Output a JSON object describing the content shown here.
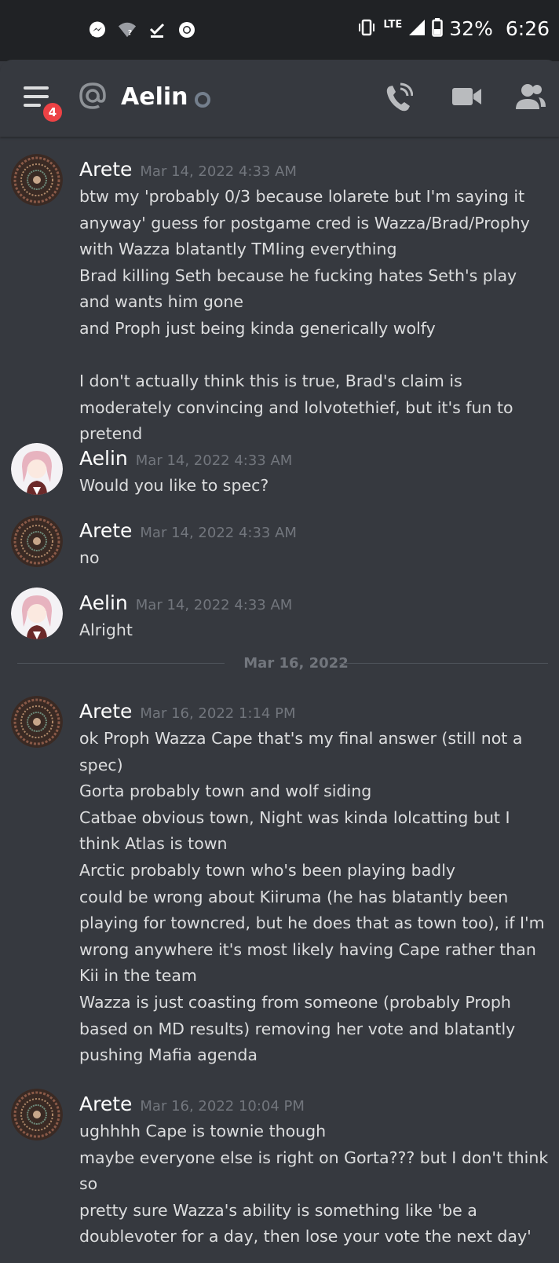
{
  "status_bar": {
    "time": "6:26",
    "battery": "32%",
    "network": "LTE",
    "icons": [
      "messenger-icon",
      "wifi-question-icon",
      "download-done-icon",
      "chrome-icon",
      "vibrate-icon",
      "signal-icon",
      "battery-icon"
    ]
  },
  "header": {
    "title": "Aelin",
    "notification_count": "4",
    "icons": [
      "menu-icon",
      "at-icon",
      "call-icon",
      "video-icon",
      "members-icon"
    ]
  },
  "messages": [
    {
      "author": "Arete",
      "timestamp": "Mar 14, 2022 4:33 AM",
      "text": "btw my 'probably 0/3 because lolarete but I'm saying it anyway' guess for postgame cred is Wazza/Brad/Prophy with Wazza blatantly TMIing everything\nBrad killing Seth because he fucking hates Seth's play and wants him gone\nand Proph just being kinda generically wolfy\n\nI don't actually think this is true, Brad's claim is moderately convincing and lolvotethief, but it's fun to pretend"
    },
    {
      "author": "Aelin",
      "timestamp": "Mar 14, 2022 4:33 AM",
      "text": "Would you like to spec?"
    },
    {
      "author": "Arete",
      "timestamp": "Mar 14, 2022 4:33 AM",
      "text": "no"
    },
    {
      "author": "Aelin",
      "timestamp": "Mar 14, 2022 4:33 AM",
      "text": "Alright"
    },
    {
      "author": "Arete",
      "timestamp": "Mar 16, 2022 1:14 PM",
      "text": "ok Proph Wazza Cape that's my final answer (still not a spec)\nGorta probably town and wolf siding\nCatbae obvious town, Night was kinda lolcatting but I think Atlas is town\nArctic probably town who's been playing badly\ncould be wrong about Kiiruma (he has blatantly been playing for towncred, but he does that as town too), if I'm wrong anywhere it's most likely having Cape rather than Kii in the team\nWazza is just coasting from someone (probably Proph based on MD results) removing her vote and blatantly pushing Mafia agenda"
    },
    {
      "author": "Arete",
      "timestamp": "Mar 16, 2022 10:04 PM",
      "text": "ughhhh Cape is townie though\nmaybe everyone else is right on Gorta??? but I don't think so\npretty sure Wazza's ability is something like 'be a doublevoter for a day, then lose your vote the next day'"
    }
  ],
  "date_divider": "Mar 16, 2022",
  "colors": {
    "background": "#36393f",
    "status_bar": "#202225",
    "badge": "#ed4245",
    "timestamp": "#72767d",
    "text": "#dcddde"
  }
}
